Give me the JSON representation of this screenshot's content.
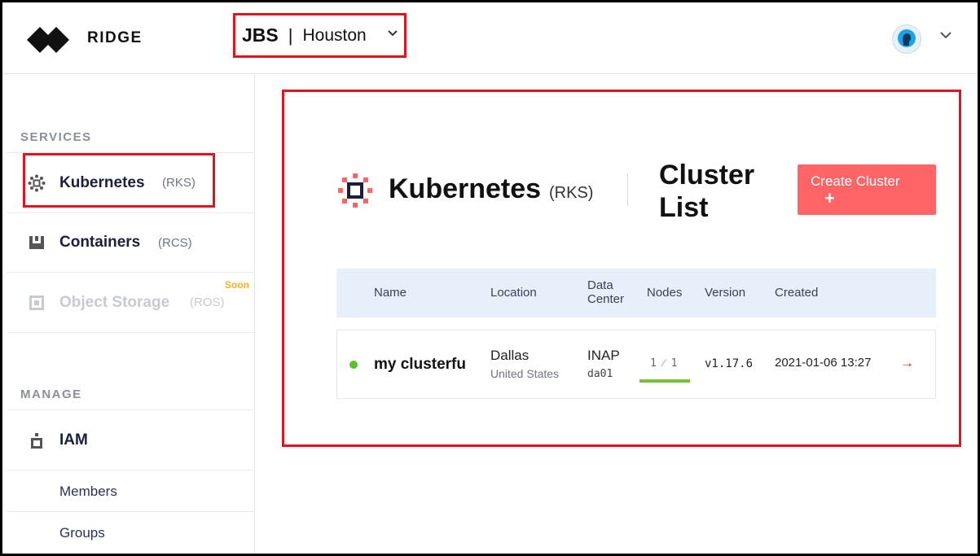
{
  "header": {
    "brand": "RIDGE",
    "org": {
      "name": "JBS",
      "separator": "|",
      "location": "Houston"
    }
  },
  "sidebar": {
    "services_label": "SERVICES",
    "services": [
      {
        "label": "Kubernetes",
        "sub": "(RKS)",
        "icon": "kubernetes-icon",
        "active": true
      },
      {
        "label": "Containers",
        "sub": "(RCS)",
        "icon": "containers-icon"
      },
      {
        "label": "Object Storage",
        "sub": "(ROS)",
        "icon": "object-storage-icon",
        "badge": "Soon",
        "disabled": true
      }
    ],
    "manage_label": "MANAGE",
    "manage": [
      {
        "label": "IAM",
        "icon": "iam-icon"
      }
    ],
    "manage_sub": [
      {
        "label": "Members"
      },
      {
        "label": "Groups"
      }
    ]
  },
  "main": {
    "title": "Kubernetes",
    "title_sub": "(RKS)",
    "list_title": "Cluster List",
    "create_button": "Create Cluster",
    "create_plus": "+",
    "table": {
      "columns": [
        "Name",
        "Location",
        "Data\nCenter",
        "Nodes",
        "Version",
        "Created"
      ],
      "rows": [
        {
          "status": "running",
          "name": "my clusterfu",
          "location_city": "Dallas",
          "location_country": "United States",
          "dc_name": "INAP",
          "dc_code": "da01",
          "nodes": "1 ⁄ 1",
          "nodes_fraction": 1.0,
          "version": "v1.17.6",
          "created": "2021-01-06 13:27",
          "arrow": "→"
        }
      ]
    }
  },
  "colors": {
    "accent": "#ff6466",
    "highlight": "#e3131e",
    "status_ok": "#58c324",
    "table_head": "#e5f0fa"
  }
}
